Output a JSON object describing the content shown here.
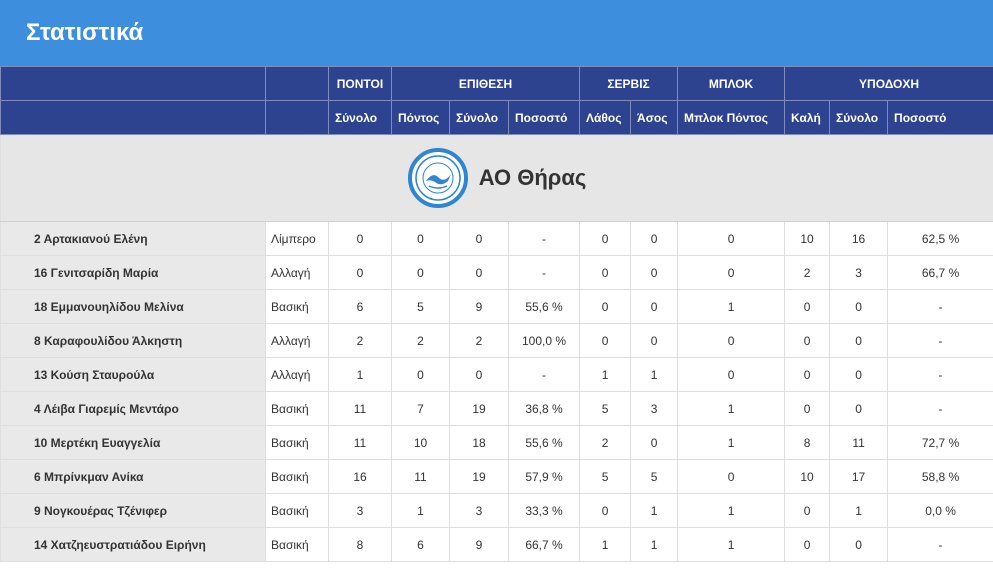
{
  "page": {
    "title": "Στατιστικά"
  },
  "groups": [
    "ΠΟΝΤΟΙ",
    "ΕΠΙΘΕΣΗ",
    "ΣΕΡΒΙΣ",
    "ΜΠΛΟΚ",
    "ΥΠΟΔΟΧΗ"
  ],
  "subheaders": [
    "Σύνολο",
    "Πόντος",
    "Σύνολο",
    "Ποσοστό",
    "Λάθος",
    "Άσος",
    "Μπλοκ Πόντος",
    "Καλή",
    "Σύνολο",
    "Ποσοστό"
  ],
  "team": {
    "name": "ΑΟ Θήρας",
    "logo_icon": "team-crest-icon"
  },
  "colors": {
    "header": "#3d8fde",
    "table_header": "#2e438f"
  },
  "players": [
    {
      "name": "2 Αρτακιανού Ελένη",
      "role": "Λίμπερο",
      "stats": [
        "0",
        "0",
        "0",
        "-",
        "0",
        "0",
        "0",
        "10",
        "16",
        "62,5 %"
      ]
    },
    {
      "name": "16 Γενιτσαρίδη Μαρία",
      "role": "Αλλαγή",
      "stats": [
        "0",
        "0",
        "0",
        "-",
        "0",
        "0",
        "0",
        "2",
        "3",
        "66,7 %"
      ]
    },
    {
      "name": "18 Εμμανουηλίδου Μελίνα",
      "role": "Βασική",
      "stats": [
        "6",
        "5",
        "9",
        "55,6 %",
        "0",
        "0",
        "1",
        "0",
        "0",
        "-"
      ]
    },
    {
      "name": "8 Καραφουλίδου Άλκηστη",
      "role": "Αλλαγή",
      "stats": [
        "2",
        "2",
        "2",
        "100,0 %",
        "0",
        "0",
        "0",
        "0",
        "0",
        "-"
      ]
    },
    {
      "name": "13 Κούση Σταυρούλα",
      "role": "Αλλαγή",
      "stats": [
        "1",
        "0",
        "0",
        "-",
        "1",
        "1",
        "0",
        "0",
        "0",
        "-"
      ]
    },
    {
      "name": "4 Λέιβα Γιαρεμίς Μεντάρο",
      "role": "Βασική",
      "stats": [
        "11",
        "7",
        "19",
        "36,8 %",
        "5",
        "3",
        "1",
        "0",
        "0",
        "-"
      ]
    },
    {
      "name": "10 Μερτέκη Ευαγγελία",
      "role": "Βασική",
      "stats": [
        "11",
        "10",
        "18",
        "55,6 %",
        "2",
        "0",
        "1",
        "8",
        "11",
        "72,7 %"
      ]
    },
    {
      "name": "6 Μπρίνκμαν Ανίκα",
      "role": "Βασική",
      "stats": [
        "16",
        "11",
        "19",
        "57,9 %",
        "5",
        "5",
        "0",
        "10",
        "17",
        "58,8 %"
      ]
    },
    {
      "name": "9 Νογκουέρας Τζένιφερ",
      "role": "Βασική",
      "stats": [
        "3",
        "1",
        "3",
        "33,3 %",
        "0",
        "1",
        "1",
        "0",
        "1",
        "0,0 %"
      ]
    },
    {
      "name": "14 Χατζηευστρατιάδου Ειρήνη",
      "role": "Βασική",
      "stats": [
        "8",
        "6",
        "9",
        "66,7 %",
        "1",
        "1",
        "1",
        "0",
        "0",
        "-"
      ]
    }
  ]
}
